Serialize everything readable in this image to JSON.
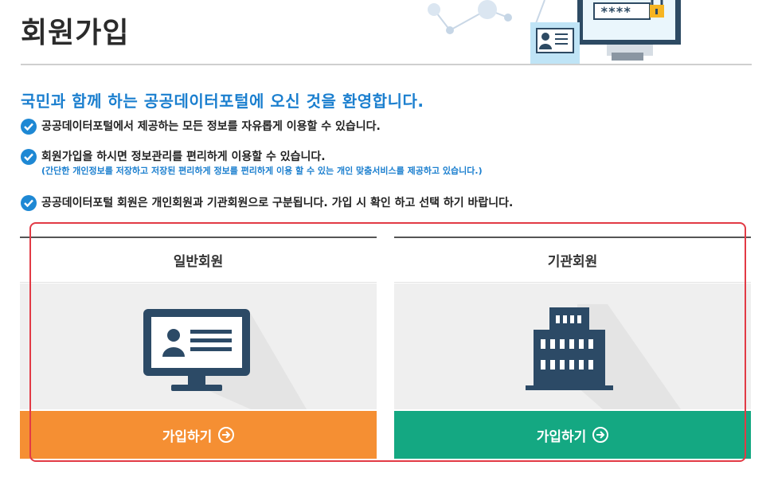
{
  "header": {
    "title": "회원가입",
    "illustration_password": "****"
  },
  "welcome": "국민과 함께 하는 공공데이터포털에 오신 것을 환영합니다.",
  "info": [
    {
      "text": "공공데이터포털에서 제공하는 모든 정보를 자유롭게 이용할 수 있습니다."
    },
    {
      "text": "회원가입을 하시면 정보관리를 편리하게 이용할 수 있습니다.",
      "sub": "(간단한 개인정보를 저장하고 저장된 편리하게 정보를 편리하게 이용 할 수 있는 개인 맞춤서비스를 제공하고 있습니다.)"
    },
    {
      "text": "공공데이터포털 회원은 개인회원과 기관회원으로 구분됩니다. 가입 시 확인 하고 선택 하기 바랍니다."
    }
  ],
  "cards": [
    {
      "title": "일반회원",
      "button_label": "가입하기",
      "icon": "monitor-id-card-icon",
      "button_color": "#f58f33"
    },
    {
      "title": "기관회원",
      "button_label": "가입하기",
      "icon": "building-icon",
      "button_color": "#14a882"
    }
  ],
  "colors": {
    "accent": "#1b7fcf",
    "check": "#1e88d4",
    "highlight": "#e23a45",
    "icon": "#2c4a66"
  }
}
